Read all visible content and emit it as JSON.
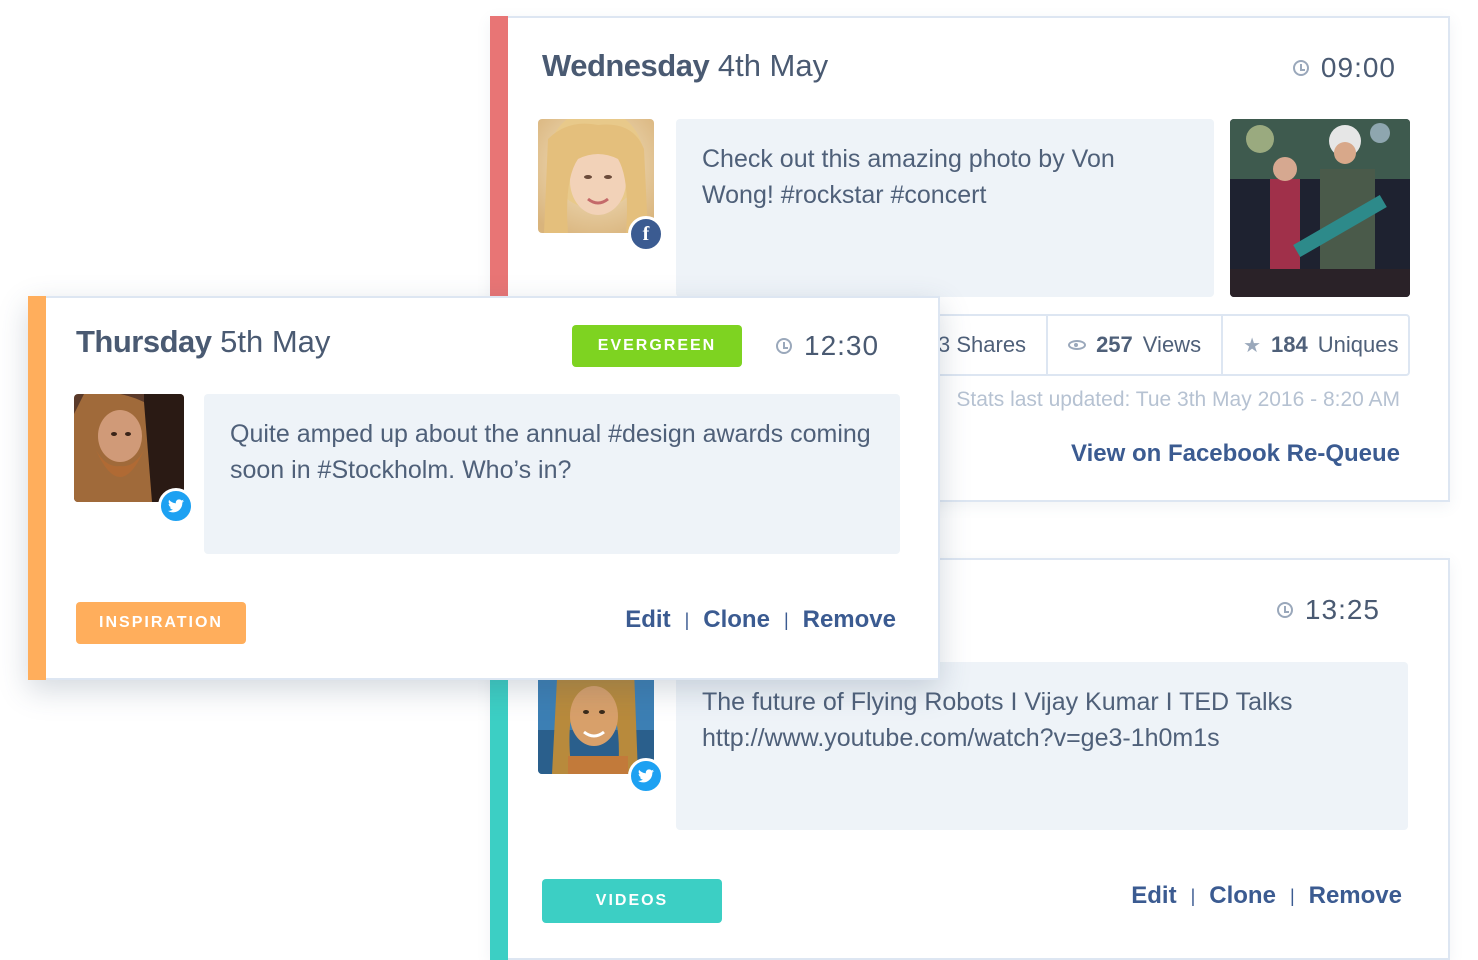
{
  "posts": {
    "wednesday": {
      "day": "Wednesday",
      "date": "4th May",
      "time": "09:00",
      "network": "facebook",
      "message": "Check out this amazing photo by Von Wong! #rockstar #concert",
      "stats": {
        "shares_label": "3 Shares",
        "views_count": "257",
        "views_label": "Views",
        "uniques_count": "184",
        "uniques_label": "Uniques"
      },
      "stats_updated": "Stats last updated: Tue 3th May 2016 - 8:20 AM",
      "view_link": "View on Facebook Re-Queue",
      "accent_color": "#e87575"
    },
    "thursday": {
      "day": "Thursday",
      "date": "5th May",
      "time": "12:30",
      "badge": "EVERGREEN",
      "badge_color": "#7ed321",
      "network": "twitter",
      "message": "Quite amped up about the annual #design awards coming soon in #Stockholm. Who’s in?",
      "category": "INSPIRATION",
      "category_color": "#ffae5c",
      "accent_color": "#ffae5c",
      "actions": {
        "edit": "Edit",
        "clone": "Clone",
        "remove": "Remove"
      }
    },
    "third": {
      "time": "13:25",
      "network": "twitter",
      "message": "The future of Flying Robots I Vijay Kumar I TED Talks http://www.youtube.com/watch?v=ge3-1h0m1s",
      "category": "VIDEOS",
      "category_color": "#3ccfc4",
      "accent_color": "#3ccfc4",
      "actions": {
        "edit": "Edit",
        "clone": "Clone",
        "remove": "Remove"
      }
    }
  },
  "icons": {
    "facebook": "facebook-icon",
    "twitter": "twitter-icon",
    "clock": "clock-icon",
    "eye": "eye-icon",
    "star": "star-icon"
  }
}
